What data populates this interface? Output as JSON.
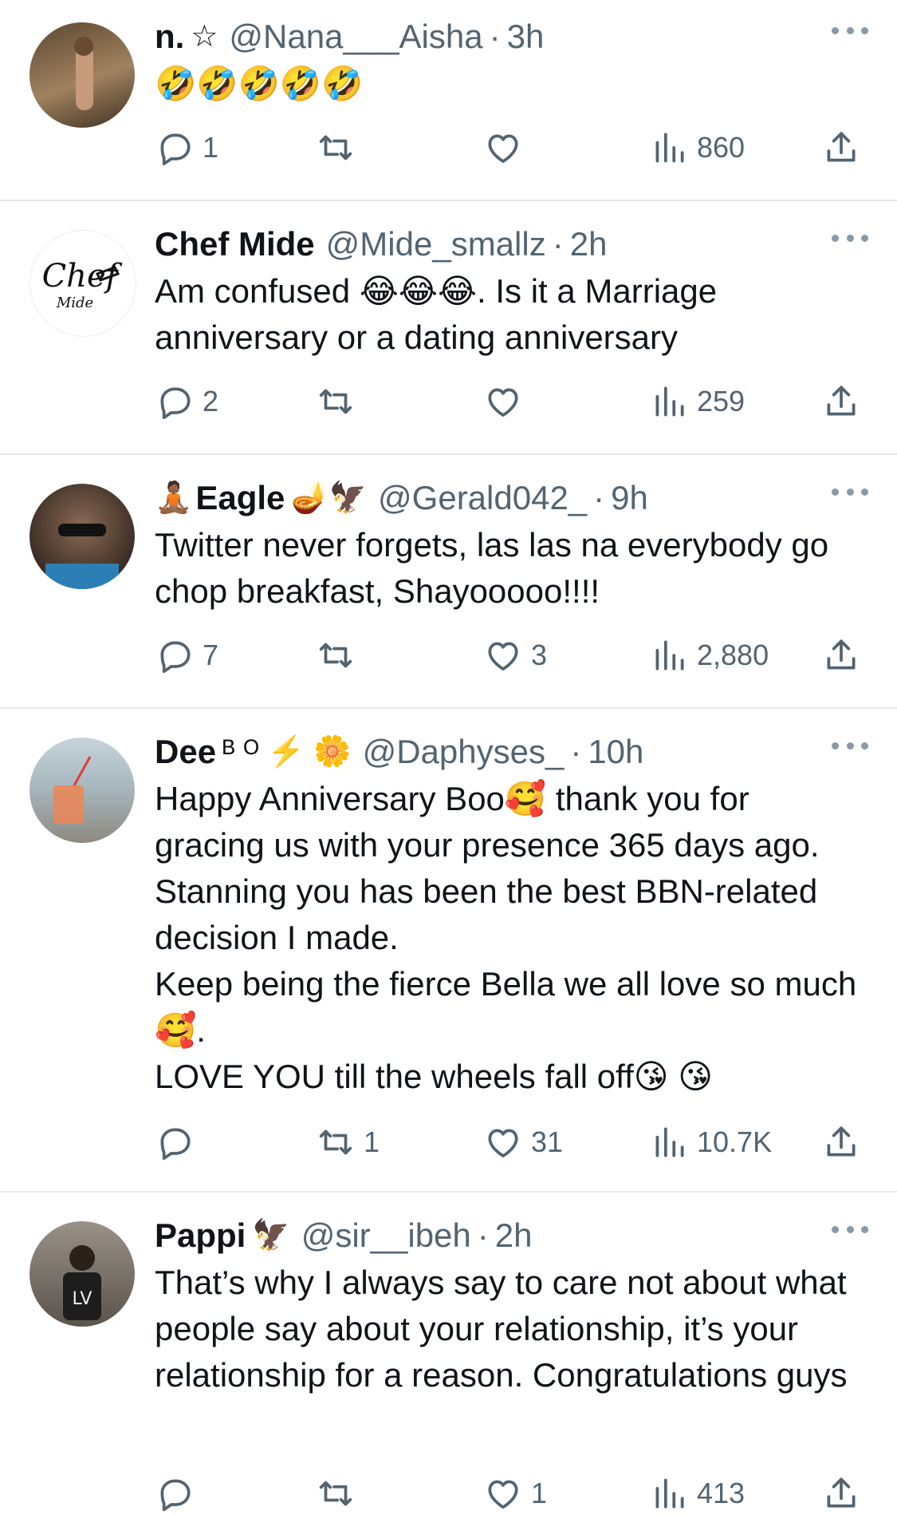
{
  "replies": [
    {
      "name": "n.",
      "name_deco": "☆",
      "handle": "@Nana___Aisha",
      "time": "3h",
      "text": "🤣🤣🤣🤣🤣",
      "replies": "1",
      "retweets": "",
      "likes": "",
      "views": "860",
      "avatar_color": "#7a5a3a"
    },
    {
      "name": "Chef Mide",
      "name_deco": "",
      "handle": "@Mide_smallz",
      "time": "2h",
      "text": "Am confused 😂😂😂. Is it a Marriage anniversary or a dating anniversary",
      "replies": "2",
      "retweets": "",
      "likes": "",
      "views": "259",
      "avatar_text": "Chef Mide",
      "avatar_color": "#ffffff"
    },
    {
      "name": "Eagle",
      "name_prefix": "🧘🏾",
      "name_deco": "🪔🦅",
      "handle": "@Gerald042_",
      "time": "9h",
      "text": "Twitter never forgets, las las na everybody go chop breakfast, Shayooooo!!!!",
      "replies": "7",
      "retweets": "",
      "likes": "3",
      "views": "2,880",
      "avatar_color": "#4a3a30"
    },
    {
      "name": "Dee",
      "name_deco": "ᴮ ᴼ ⚡️ 🌼",
      "handle": "@Daphyses_",
      "time": "10h",
      "text_lines": [
        "Happy Anniversary Boo🥰 thank you for gracing us with your presence 365 days ago. Stanning you has been the best BBN-related decision I made.",
        "Keep being the fierce Bella we all love so much🥰.",
        "LOVE YOU till the wheels fall off😘 😘"
      ],
      "replies": "",
      "retweets": "1",
      "likes": "31",
      "views": "10.7K",
      "avatar_color": "#c98a6a"
    },
    {
      "name": "Pappi",
      "name_deco": "🦅",
      "handle": "@sir__ibeh",
      "time": "2h",
      "text": "That’s why I always say to care not about what people say about your relationship, it’s your relationship for a reason. Congratulations guys",
      "replies": "",
      "retweets": "",
      "likes": "1",
      "views": "413",
      "avatar_color": "#6b6258"
    }
  ],
  "colors": {
    "text": "#0f1419",
    "secondary": "#536471",
    "divider": "#e6e9ec"
  },
  "icons": [
    "reply-icon",
    "retweet-icon",
    "like-icon",
    "views-icon",
    "share-icon",
    "more-icon"
  ]
}
